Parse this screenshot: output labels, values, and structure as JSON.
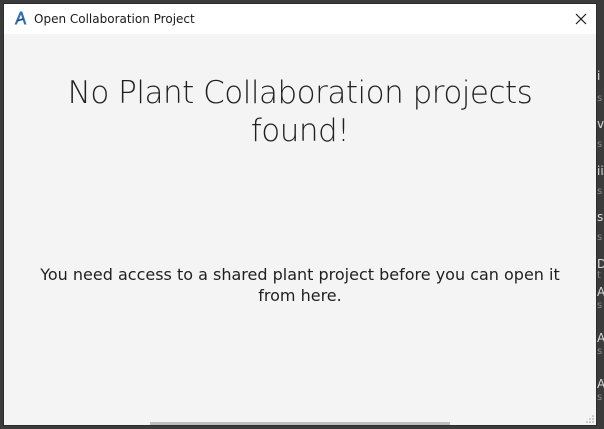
{
  "window": {
    "title": "Open Collaboration Project",
    "app_icon": "autodesk-a-icon",
    "close_icon": "close-icon"
  },
  "main": {
    "heading": "No Plant Collaboration projects found!",
    "message": "You need access to a shared plant project before you can open it from here."
  },
  "background": {
    "fragments": [
      "i",
      "s",
      "v",
      "s",
      "ii",
      "s",
      "s",
      "s",
      "D",
      "t",
      "A",
      "s",
      "A",
      "s",
      "A",
      "s"
    ]
  },
  "colors": {
    "dialog_bg": "#f4f4f4",
    "titlebar_bg": "#ffffff",
    "app_bg": "#3b3b3b",
    "icon_blue": "#2f6fb5"
  }
}
